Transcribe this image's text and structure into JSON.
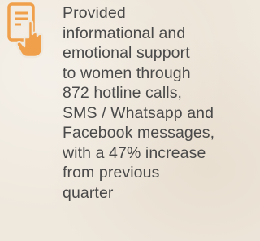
{
  "icon": "phone-tap-icon",
  "colors": {
    "accent": "#f0a04b",
    "text": "#4a4a4a",
    "background": "#efe8dd"
  },
  "stat": {
    "lines": [
      "Provided",
      "informational and",
      "emotional support",
      "to women through",
      "872 hotline calls,",
      "SMS / Whatsapp and",
      "Facebook messages,",
      "with a 47% increase",
      "from previous",
      "quarter"
    ]
  }
}
